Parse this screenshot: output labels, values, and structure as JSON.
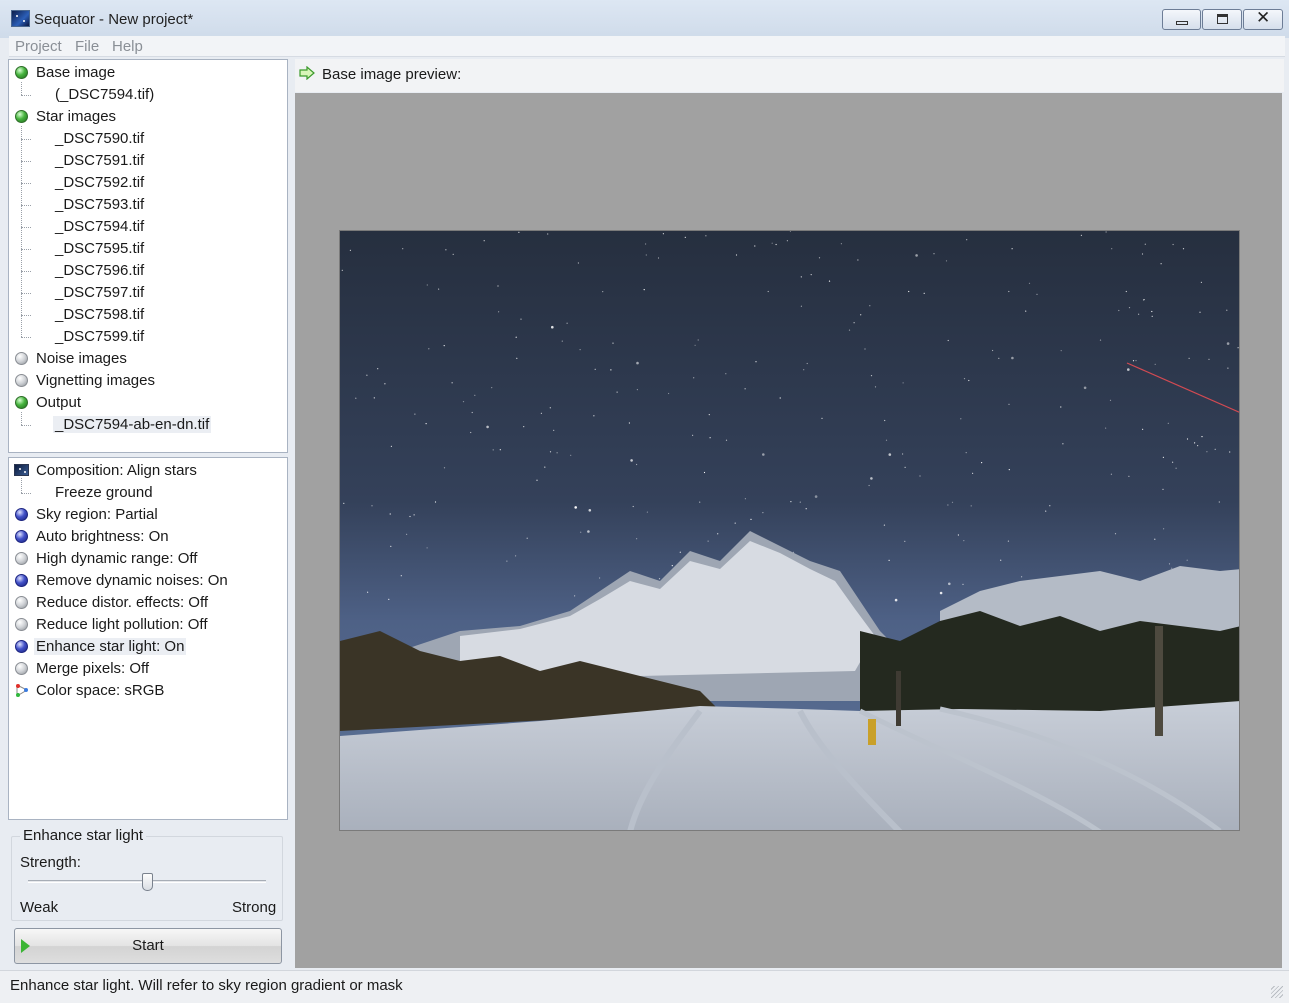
{
  "window": {
    "title": "Sequator - New project*"
  },
  "menu": {
    "items": [
      "Project",
      "File",
      "Help"
    ]
  },
  "tree": {
    "base": {
      "label": "Base image",
      "file": "(_DSC7594.tif)"
    },
    "star": {
      "label": "Star images",
      "files": [
        "_DSC7590.tif",
        "_DSC7591.tif",
        "_DSC7592.tif",
        "_DSC7593.tif",
        "_DSC7594.tif",
        "_DSC7595.tif",
        "_DSC7596.tif",
        "_DSC7597.tif",
        "_DSC7598.tif",
        "_DSC7599.tif"
      ]
    },
    "noise": {
      "label": "Noise images"
    },
    "vignetting": {
      "label": "Vignetting images"
    },
    "output": {
      "label": "Output",
      "file": "_DSC7594-ab-en-dn.tif"
    }
  },
  "options": {
    "composition": "Composition: Align stars",
    "freeze": "Freeze ground",
    "sky": "Sky region: Partial",
    "auto_brightness": "Auto brightness: On",
    "hdr": "High dynamic range: Off",
    "dyn_noise": "Remove dynamic noises: On",
    "distortion": "Reduce distor. effects: Off",
    "light_pollution": "Reduce light pollution: Off",
    "enhance": "Enhance star light: On",
    "merge": "Merge pixels: Off",
    "color_space": "Color space: sRGB"
  },
  "settings": {
    "group_title": "Enhance star light",
    "strength_label": "Strength:",
    "strength_value": 0.5,
    "weak": "Weak",
    "strong": "Strong",
    "start": "Start"
  },
  "preview": {
    "label": "Base image preview:"
  },
  "status": {
    "text": "Enhance star light. Will refer to sky region gradient or mask"
  },
  "colors": {
    "accent_green": "#3bb534",
    "blue_dot": "#4352c9",
    "preview_bg": "#a1a1a1"
  }
}
